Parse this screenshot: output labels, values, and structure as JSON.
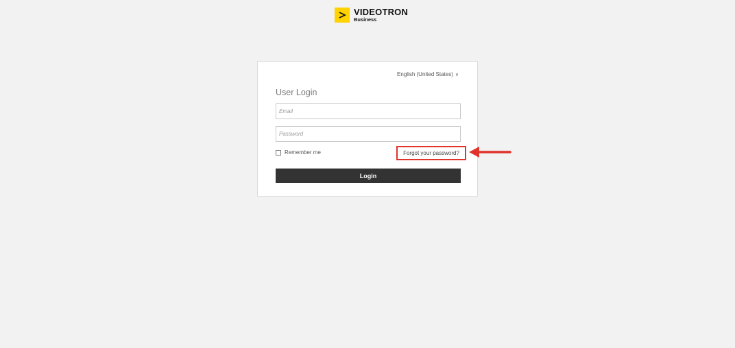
{
  "logo": {
    "brand": "VIDEOTRON",
    "sub": "Business",
    "icon": "chevron-right-icon",
    "color": "#ffd200"
  },
  "login": {
    "language": "English (United States)",
    "language_icon": "chevron-down-icon",
    "title": "User Login",
    "email_placeholder": "Email",
    "password_placeholder": "Password",
    "remember_label": "Remember me",
    "forgot_label": "Forgot your password?",
    "button_label": "Login"
  },
  "colors": {
    "background": "#f2f2f2",
    "button": "#333333",
    "highlight": "#e0332b"
  }
}
